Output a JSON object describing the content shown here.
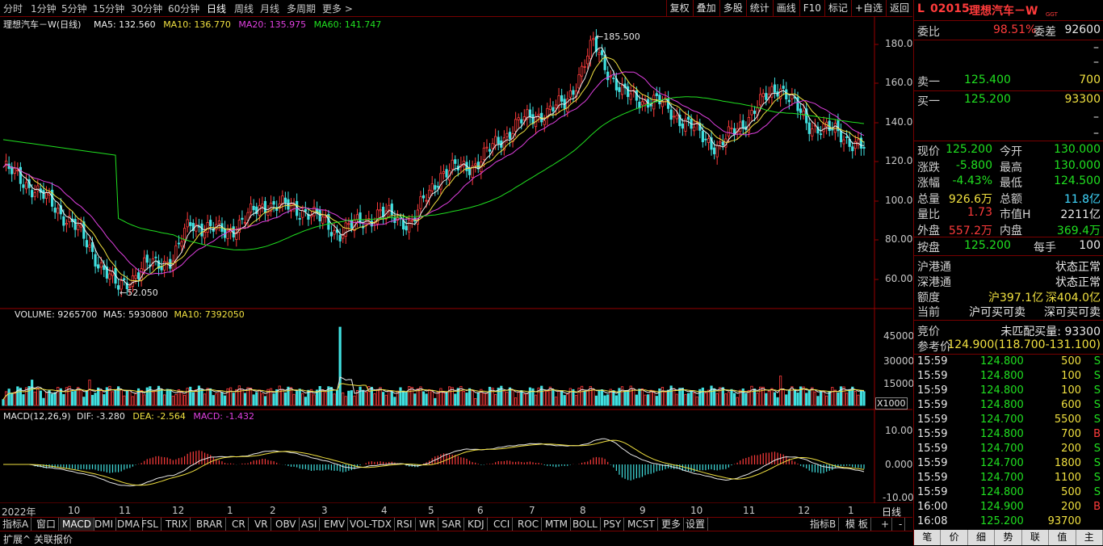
{
  "periods": [
    "分时",
    "1分钟",
    "5分钟",
    "15分钟",
    "30分钟",
    "60分钟",
    "日线",
    "周线",
    "月线",
    "多周期",
    "更多 >"
  ],
  "active_period": "日线",
  "top_tools": [
    "复权",
    "叠加",
    "多股",
    "统计",
    "画线",
    "F10",
    "标记",
    "+自选",
    "返回"
  ],
  "kline": {
    "title": "理想汽车－W(日线)",
    "ma_legend": [
      {
        "label": "MA5: 132.560",
        "color": "#f0f0f0"
      },
      {
        "label": "MA10: 136.770",
        "color": "#f0e040"
      },
      {
        "label": "MA20: 135.975",
        "color": "#e040e0"
      },
      {
        "label": "MA60: 141.747",
        "color": "#20e020"
      }
    ],
    "y_ticks": [
      "180.0",
      "160.0",
      "140.0",
      "120.0",
      "100.0",
      "80.00",
      "60.00"
    ],
    "high_label": "185.500",
    "low_label": "52.050"
  },
  "volume": {
    "legend": [
      {
        "label": "VOLUME: 9265700",
        "color": "#e8e8e8"
      },
      {
        "label": "MA5: 5930800",
        "color": "#e8e8e8"
      },
      {
        "label": "MA10: 7392050",
        "color": "#f0e040"
      }
    ],
    "y_ticks": [
      "45000",
      "30000",
      "15000"
    ],
    "unit": "X1000"
  },
  "macd": {
    "legend": [
      {
        "label": "MACD(12,26,9)",
        "color": "#e8e8e8"
      },
      {
        "label": "DIF: -3.280",
        "color": "#e8e8e8"
      },
      {
        "label": "DEA: -2.564",
        "color": "#f0e040"
      },
      {
        "label": "MACD: -1.432",
        "color": "#e040e0"
      }
    ],
    "y_ticks": [
      "10.00",
      "0.000",
      "-10.00"
    ]
  },
  "time_axis": {
    "labels": [
      "2022年",
      "10",
      "11",
      "12",
      "1",
      "2",
      "3",
      "4",
      "5",
      "6",
      "7",
      "8",
      "9",
      "10",
      "11",
      "12",
      "1"
    ],
    "right_label": "日线"
  },
  "indicator_tabs": [
    "指标A",
    "窗口",
    "MACD",
    "DMI",
    "DMA",
    "FSL",
    "TRIX",
    "BRAR",
    "CR",
    "VR",
    "OBV",
    "ASI",
    "EMV",
    "VOL-TDX",
    "RSI",
    "WR",
    "SAR",
    "KDJ",
    "CCI",
    "ROC",
    "MTM",
    "BOLL",
    "PSY",
    "MCST",
    "更多",
    "设置"
  ],
  "active_indicator": "MACD",
  "indicator_right": [
    "指标B",
    "模 板",
    "+",
    "-"
  ],
  "status_left": [
    "扩展^",
    "关联报价"
  ],
  "stock": {
    "prefix": "L",
    "code": "02015",
    "name": "理想汽车－W",
    "tag": "GGT"
  },
  "order_book": {
    "weibi_label": "委比",
    "weibi": "98.51%",
    "weicha_label": "委差",
    "weicha": "92600",
    "sell1_label": "卖一",
    "sell1_price": "125.400",
    "sell1_vol": "700",
    "buy1_label": "买一",
    "buy1_price": "125.200",
    "buy1_vol": "93300",
    "dash": "–"
  },
  "quote": [
    {
      "l1": "现价",
      "v1": "125.200",
      "c1": "green",
      "l2": "今开",
      "v2": "130.000",
      "c2": "green"
    },
    {
      "l1": "涨跌",
      "v1": "-5.800",
      "c1": "green",
      "l2": "最高",
      "v2": "130.000",
      "c2": "green"
    },
    {
      "l1": "涨幅",
      "v1": "-4.43%",
      "c1": "green",
      "l2": "最低",
      "v2": "124.500",
      "c2": "green"
    },
    {
      "l1": "总量",
      "v1": "926.6万",
      "c1": "yellow",
      "l2": "总额",
      "v2": "11.8亿",
      "c2": "cyan"
    },
    {
      "l1": "量比",
      "v1": "1.73",
      "c1": "red",
      "l2": "市值H",
      "v2": "2211亿",
      "c2": "white"
    },
    {
      "l1": "外盘",
      "v1": "557.2万",
      "c1": "red",
      "l2": "内盘",
      "v2": "369.4万",
      "c2": "green"
    }
  ],
  "anpan": {
    "label": "按盘",
    "value": "125.200",
    "label2": "每手",
    "value2": "100"
  },
  "connect": [
    {
      "l": "沪港通",
      "v": "状态正常"
    },
    {
      "l": "深港通",
      "v": "状态正常"
    }
  ],
  "quota": {
    "label": "额度",
    "v1": "沪397.1亿",
    "v2": "深404.0亿"
  },
  "current": {
    "label": "当前",
    "v1": "沪可买可卖",
    "v2": "深可买可卖"
  },
  "auction": {
    "label": "竞价",
    "value": "未匹配买量: 93300"
  },
  "ref_price": {
    "label": "参考价",
    "value": "124.900(118.700-131.100)"
  },
  "ticks": [
    {
      "t": "15:59",
      "p": "124.800",
      "pc": "green",
      "v": "500",
      "s": "S"
    },
    {
      "t": "15:59",
      "p": "124.800",
      "pc": "green",
      "v": "100",
      "s": "S"
    },
    {
      "t": "15:59",
      "p": "124.800",
      "pc": "green",
      "v": "100",
      "s": "S"
    },
    {
      "t": "15:59",
      "p": "124.800",
      "pc": "green",
      "v": "600",
      "s": "S"
    },
    {
      "t": "15:59",
      "p": "124.700",
      "pc": "green",
      "v": "5500",
      "s": "S"
    },
    {
      "t": "15:59",
      "p": "124.800",
      "pc": "green",
      "v": "700",
      "s": "B"
    },
    {
      "t": "15:59",
      "p": "124.700",
      "pc": "green",
      "v": "200",
      "s": "S"
    },
    {
      "t": "15:59",
      "p": "124.700",
      "pc": "green",
      "v": "1800",
      "s": "S"
    },
    {
      "t": "15:59",
      "p": "124.700",
      "pc": "green",
      "v": "1100",
      "s": "S"
    },
    {
      "t": "15:59",
      "p": "124.800",
      "pc": "green",
      "v": "500",
      "s": "S"
    },
    {
      "t": "16:00",
      "p": "124.900",
      "pc": "green",
      "v": "200",
      "s": "B"
    },
    {
      "t": "16:08",
      "p": "125.200",
      "pc": "green",
      "v": "93700",
      "s": ""
    }
  ],
  "bottom_tabs": [
    "笔",
    "价",
    "细",
    "势",
    "联",
    "值",
    "主"
  ]
}
